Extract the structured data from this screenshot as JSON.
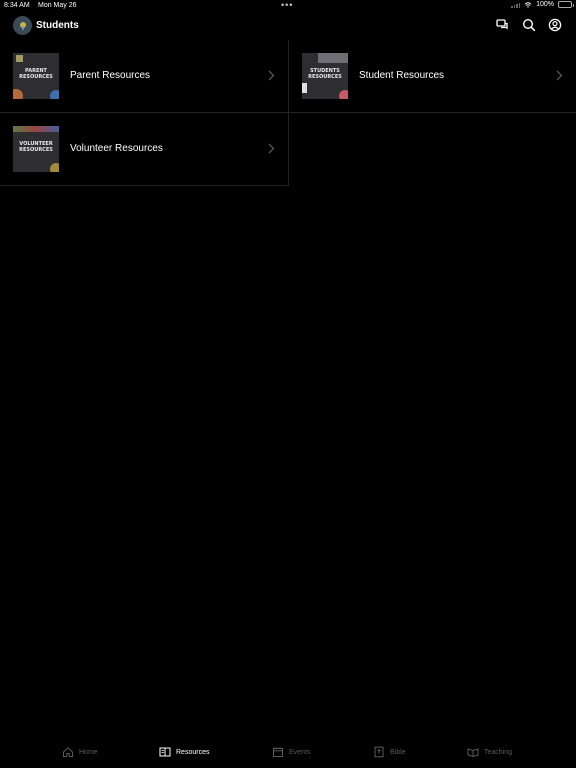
{
  "status": {
    "time": "8:34 AM",
    "date": "Mon May 26",
    "battery": "100%",
    "dots": "•••"
  },
  "nav": {
    "title": "Students"
  },
  "resources": [
    {
      "label": "Parent Resources",
      "thumb": "PARENT RESOURCES"
    },
    {
      "label": "Student Resources",
      "thumb": "STUDENTS RESOURCES"
    },
    {
      "label": "Volunteer Resources",
      "thumb": "VOLUNTEER RESOURCES"
    }
  ],
  "tabs": [
    {
      "label": "Home",
      "icon": "home-icon"
    },
    {
      "label": "Resources",
      "icon": "book-icon",
      "active": true
    },
    {
      "label": "Events",
      "icon": "calendar-icon"
    },
    {
      "label": "Bible",
      "icon": "bible-icon"
    },
    {
      "label": "Teaching",
      "icon": "teaching-icon"
    }
  ]
}
